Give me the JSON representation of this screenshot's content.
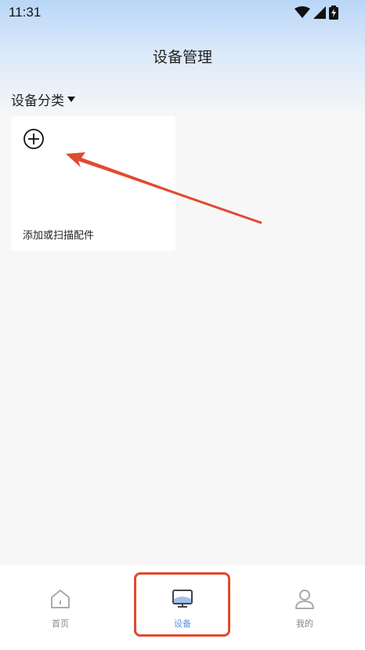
{
  "status_bar": {
    "time": "11:31",
    "icons": [
      "wifi-icon",
      "signal-icon",
      "battery-charging-icon"
    ]
  },
  "header": {
    "title": "设备管理"
  },
  "category": {
    "label": "设备分类",
    "icon": "caret-down-icon"
  },
  "add_card": {
    "label": "添加或扫描配件",
    "icon": "plus-circle-icon"
  },
  "bottom_nav": {
    "items": [
      {
        "label": "首页",
        "icon": "home-icon",
        "active": false
      },
      {
        "label": "设备",
        "icon": "device-monitor-icon",
        "active": true
      },
      {
        "label": "我的",
        "icon": "user-icon",
        "active": false
      }
    ]
  },
  "colors": {
    "accent": "#5b93e6",
    "annotation": "#e04a2e",
    "header_gradient_top": "#b9d6f7",
    "background": "#f7f7f7"
  }
}
